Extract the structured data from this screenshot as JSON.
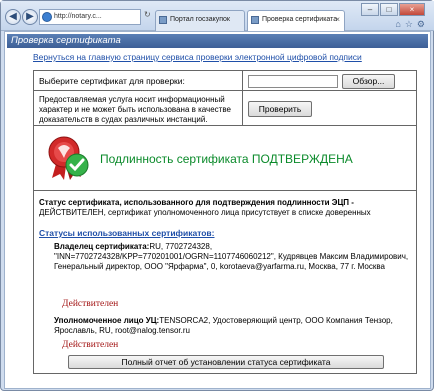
{
  "browser": {
    "address": "http://notary.c...",
    "tabs": [
      {
        "label": "Портал госзакупок"
      },
      {
        "label": "Проверка сертификата"
      }
    ],
    "close_glyph": "×",
    "window_controls": {
      "minimize": "–",
      "maximize": "□",
      "close": "×"
    },
    "toolbar_icons": [
      "home-icon",
      "star-icon",
      "gear-icon"
    ]
  },
  "page": {
    "title": "Проверка сертификата",
    "back_link": "Вернуться на главную страницу сервиса проверки электронной цифровой подписи",
    "choose_label": "Выберите сертификат для проверки:",
    "browse_button": "Обзор...",
    "note": "Предоставляемая услуга носит информационный характер и не может быть использована в качестве доказательств в судах различных инстанций.",
    "check_button": "Проверить",
    "confirmed": "Подлинность сертификата ПОДТВЕРЖДЕНА",
    "status_heading": "Статус сертификата, использованного для подтверждения подлинности ЭЦП -",
    "status_text": "ДЕЙСТВИТЕЛЕН, сертификат уполномоченного лица присутствует в списке доверенных",
    "statuses_link": "Статусы использованных сертификатов:",
    "owner_label": "Владелец сертификата:",
    "owner_text": "RU, 7702724328, \"INN=7702724328/KPP=770201001/OGRN=1107746060212\", Кудрявцев Максим Владимирович, Генеральный директор, ООО \"Ярфарма\", 0, korotaeva@yarfarma.ru, Москва, 77 г. Москва",
    "owner_status": "Действителен",
    "ca_label": "Уполномоченное лицо УЦ:",
    "ca_text": "TENSORCA2, Удостоверяющий центр, ООО Компания Тензор, Ярославль, RU, root@nalog.tensor.ru",
    "ca_status": "Действителен",
    "report_button": "Полный отчет об установлении статуса сертификата"
  },
  "colors": {
    "confirmed": "#0a8a2a",
    "valid": "#a31515",
    "title_bar": "#3d5f96",
    "link": "#1f4fa8"
  }
}
